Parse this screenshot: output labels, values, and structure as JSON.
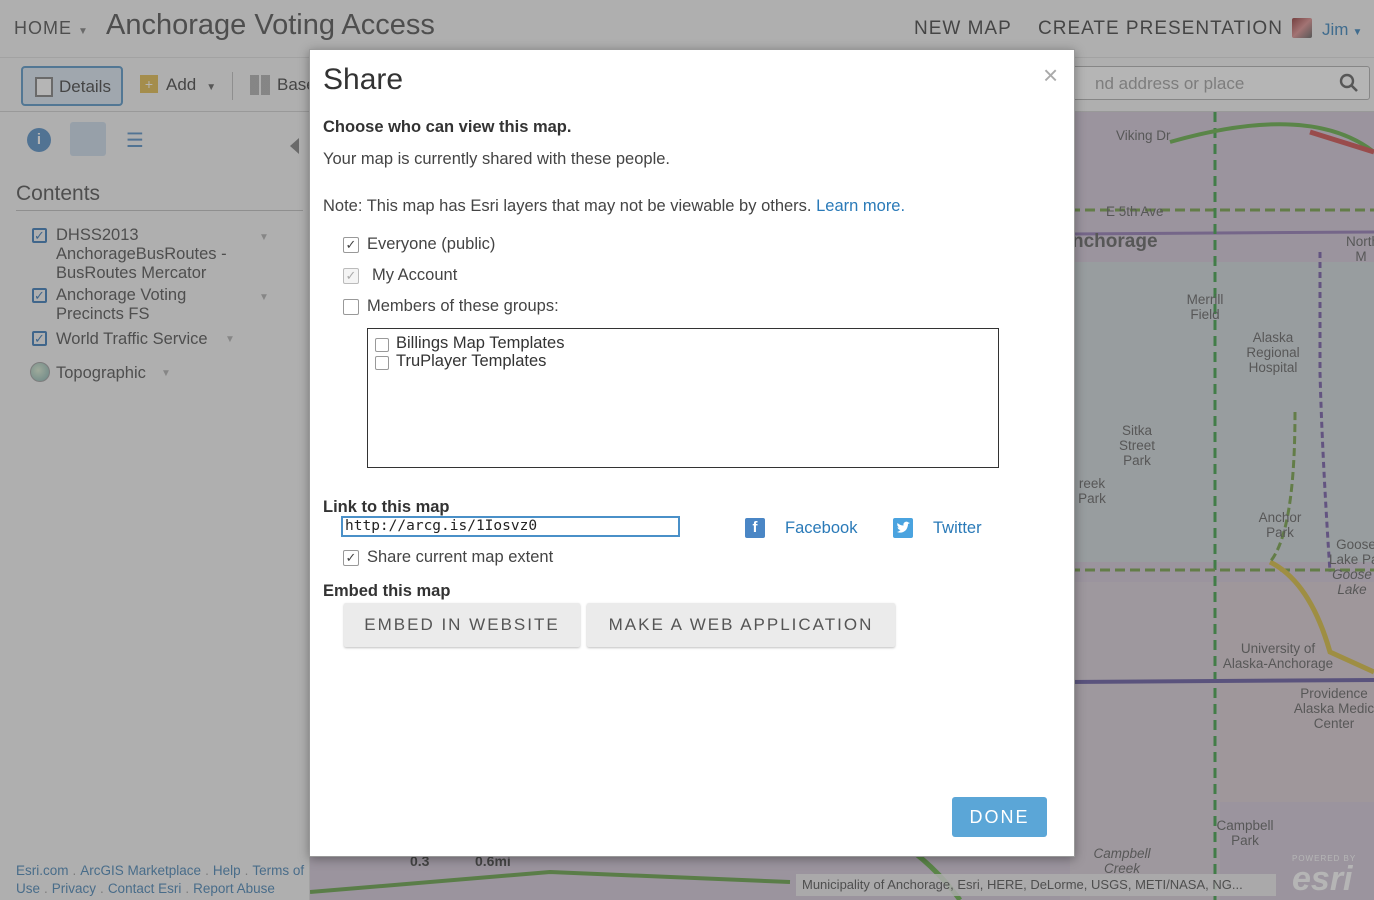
{
  "header": {
    "home_label": "HOME",
    "app_title": "Anchorage Voting Access",
    "new_map_label": "NEW MAP",
    "create_presentation_label": "CREATE PRESENTATION",
    "user_name": "Jim"
  },
  "toolbar": {
    "details_label": "Details",
    "add_label": "Add",
    "basemap_label": "Base",
    "search_placeholder": "nd address or place"
  },
  "sidebar": {
    "contents_title": "Contents",
    "layers": [
      {
        "name": "DHSS2013 AnchorageBusRoutes - BusRoutes Mercator",
        "checked": true
      },
      {
        "name": "Anchorage Voting Precincts FS",
        "checked": true
      },
      {
        "name": "World Traffic Service",
        "checked": true
      },
      {
        "name": "Topographic",
        "checked": false
      }
    ],
    "footer": {
      "esri": "Esri.com",
      "marketplace": "ArcGIS Marketplace",
      "help": "Help",
      "terms": "Terms of Use",
      "privacy": "Privacy",
      "contact": "Contact Esri",
      "report": "Report Abuse"
    }
  },
  "map": {
    "labels": {
      "viking": "Viking Dr",
      "street": "E 5th Ave",
      "anchorage": "nchorage",
      "north": "North M",
      "merrill": "Merrill Field",
      "alaska_hospital": "Alaska Regional Hospital",
      "sitka": "Sitka Street Park",
      "creek_park": "reek Park",
      "anchor_park": "Anchor Park",
      "goose": "Goose Lake Par",
      "goose_lake": "Goose Lake",
      "university": "University of Alaska-Anchorage",
      "providence": "Providence Alaska Medic Center",
      "campbell": "Campbell Park",
      "creek": "Campbell Creek"
    },
    "scale_a": "0.3",
    "scale_b": "0.6mi",
    "attribution": "Municipality of Anchorage, Esri, HERE, DeLorme, USGS, METI/NASA, NG...",
    "logo_small": "POWERED BY",
    "logo_big": "esri"
  },
  "dialog": {
    "title": "Share",
    "close_symbol": "×",
    "who_heading": "Choose who can view this map.",
    "shared_text": "Your map is currently shared with these people.",
    "note_text": "Note: This map has Esri layers that may not be viewable by others.",
    "learn_more": "Learn more.",
    "options": {
      "everyone": {
        "label": "Everyone (public)",
        "checked": true
      },
      "my_account": {
        "label": "My Account",
        "checked": true,
        "disabled": true
      },
      "members": {
        "label": "Members of these groups:",
        "checked": false
      }
    },
    "groups": [
      {
        "label": "Billings Map Templates",
        "checked": false
      },
      {
        "label": "TruPlayer Templates",
        "checked": false
      }
    ],
    "link_heading": "Link to this map",
    "link_value": "http://arcg.is/1Iosvz0",
    "facebook_label": "Facebook",
    "twitter_label": "Twitter",
    "share_extent": {
      "label": "Share current map extent",
      "checked": true
    },
    "embed_heading": "Embed this map",
    "embed_website_label": "EMBED IN WEBSITE",
    "make_webapp_label": "MAKE A WEB APPLICATION",
    "done_label": "DONE"
  },
  "colors": {
    "accent": "#2a7ab8",
    "done": "#5ba6d7"
  }
}
